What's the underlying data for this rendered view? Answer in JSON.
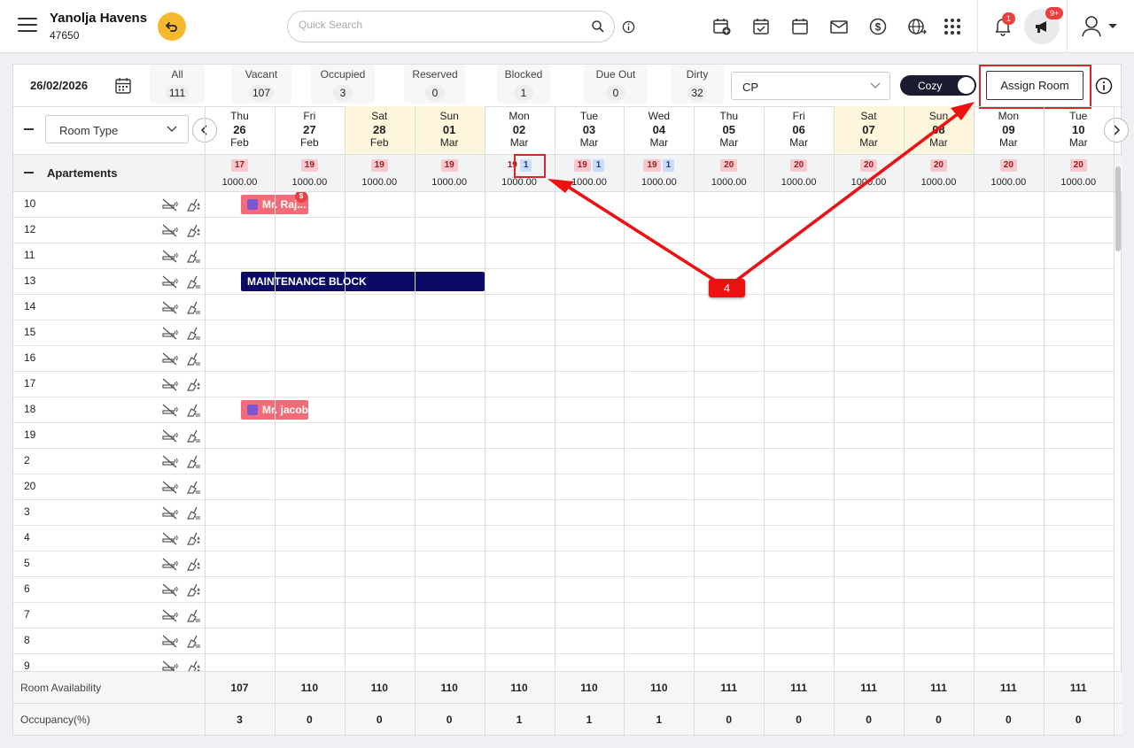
{
  "header": {
    "hotel_name": "Yanolja Havens",
    "hotel_id": "47650",
    "search_placeholder": "Quick Search",
    "notification_count": "1",
    "announcement_count": "9+"
  },
  "toolbar": {
    "date": "26/02/2026",
    "stats": [
      {
        "label": "All",
        "value": "111"
      },
      {
        "label": "Vacant",
        "value": "107"
      },
      {
        "label": "Occupied",
        "value": "3"
      },
      {
        "label": "Reserved",
        "value": "0"
      },
      {
        "label": "Blocked",
        "value": "1"
      },
      {
        "label": "Due Out",
        "value": "0"
      },
      {
        "label": "Dirty",
        "value": "32"
      }
    ],
    "rate_plan": "CP",
    "view_toggle": "Cozy",
    "assign_label": "Assign Room"
  },
  "grid": {
    "room_type_placeholder": "Room Type",
    "section": "Apartements",
    "dates": [
      {
        "day": "Thu",
        "num": "26",
        "mon": "Feb",
        "weekend": false,
        "avail": "17",
        "blocked": "",
        "rate": "1000.00"
      },
      {
        "day": "Fri",
        "num": "27",
        "mon": "Feb",
        "weekend": false,
        "avail": "19",
        "blocked": "",
        "rate": "1000.00"
      },
      {
        "day": "Sat",
        "num": "28",
        "mon": "Feb",
        "weekend": true,
        "avail": "19",
        "blocked": "",
        "rate": "1000.00"
      },
      {
        "day": "Sun",
        "num": "01",
        "mon": "Mar",
        "weekend": true,
        "avail": "19",
        "blocked": "",
        "rate": "1000.00"
      },
      {
        "day": "Mon",
        "num": "02",
        "mon": "Mar",
        "weekend": false,
        "avail": "19",
        "blocked": "1",
        "rate": "1000.00"
      },
      {
        "day": "Tue",
        "num": "03",
        "mon": "Mar",
        "weekend": false,
        "avail": "19",
        "blocked": "1",
        "rate": "1000.00"
      },
      {
        "day": "Wed",
        "num": "04",
        "mon": "Mar",
        "weekend": false,
        "avail": "19",
        "blocked": "1",
        "rate": "1000.00"
      },
      {
        "day": "Thu",
        "num": "05",
        "mon": "Mar",
        "weekend": false,
        "avail": "20",
        "blocked": "",
        "rate": "1000.00"
      },
      {
        "day": "Fri",
        "num": "06",
        "mon": "Mar",
        "weekend": false,
        "avail": "20",
        "blocked": "",
        "rate": "1000.00"
      },
      {
        "day": "Sat",
        "num": "07",
        "mon": "Mar",
        "weekend": true,
        "avail": "20",
        "blocked": "",
        "rate": "1000.00"
      },
      {
        "day": "Sun",
        "num": "08",
        "mon": "Mar",
        "weekend": true,
        "avail": "20",
        "blocked": "",
        "rate": "1000.00"
      },
      {
        "day": "Mon",
        "num": "09",
        "mon": "Mar",
        "weekend": false,
        "avail": "20",
        "blocked": "",
        "rate": "1000.00"
      },
      {
        "day": "Tue",
        "num": "10",
        "mon": "Mar",
        "weekend": false,
        "avail": "20",
        "blocked": "",
        "rate": "1000.00"
      }
    ],
    "rooms": [
      {
        "no": "10",
        "clean": true
      },
      {
        "no": "12",
        "clean": true
      },
      {
        "no": "11",
        "clean": false
      },
      {
        "no": "13",
        "clean": false
      },
      {
        "no": "14",
        "clean": false
      },
      {
        "no": "15",
        "clean": false
      },
      {
        "no": "16",
        "clean": false
      },
      {
        "no": "17",
        "clean": true
      },
      {
        "no": "18",
        "clean": false
      },
      {
        "no": "19",
        "clean": false
      },
      {
        "no": "2",
        "clean": false
      },
      {
        "no": "20",
        "clean": false
      },
      {
        "no": "3",
        "clean": false
      },
      {
        "no": "4",
        "clean": true
      },
      {
        "no": "5",
        "clean": true
      },
      {
        "no": "6",
        "clean": true
      },
      {
        "no": "7",
        "clean": false
      },
      {
        "no": "8",
        "clean": false
      },
      {
        "no": "9",
        "clean": true
      }
    ],
    "bookings": [
      {
        "room_index": 0,
        "label": "Mr. Raj...",
        "type": "guest",
        "start": 0,
        "days": 1,
        "paid_flag": "$"
      },
      {
        "room_index": 3,
        "label": "MAINTENANCE BLOCK",
        "type": "maint",
        "start": 0,
        "days": 4,
        "paid_flag": ""
      },
      {
        "room_index": 8,
        "label": "Mr. jacob",
        "type": "guest",
        "start": 0,
        "days": 1,
        "paid_flag": ""
      }
    ],
    "footer": {
      "availability_label": "Room Availability",
      "availability": [
        "107",
        "110",
        "110",
        "110",
        "110",
        "110",
        "110",
        "111",
        "111",
        "111",
        "111",
        "111",
        "111"
      ],
      "occupancy_label": "Occupancy(%)",
      "occupancy": [
        "3",
        "0",
        "0",
        "0",
        "1",
        "1",
        "1",
        "0",
        "0",
        "0",
        "0",
        "0",
        "0"
      ]
    }
  },
  "annotation": {
    "step": "4"
  }
}
